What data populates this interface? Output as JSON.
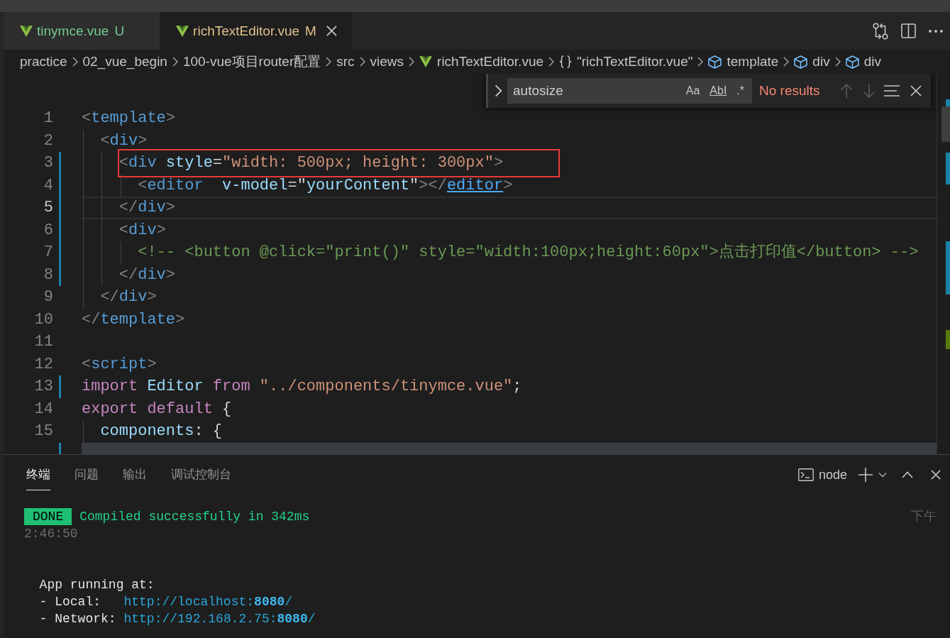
{
  "tabs": [
    {
      "label": "tinymce.vue",
      "status": "U",
      "kind": "untracked",
      "selected": false
    },
    {
      "label": "richTextEditor.vue",
      "status": "M",
      "kind": "modified",
      "selected": true
    }
  ],
  "breadcrumbs": [
    {
      "kind": "folder",
      "label": "practice"
    },
    {
      "kind": "folder",
      "label": "02_vue_begin"
    },
    {
      "kind": "folder",
      "label": "100-vue项目router配置"
    },
    {
      "kind": "folder",
      "label": "src"
    },
    {
      "kind": "folder",
      "label": "views"
    },
    {
      "kind": "file",
      "label": "richTextEditor.vue"
    },
    {
      "kind": "module",
      "label": "\"richTextEditor.vue\""
    },
    {
      "kind": "element",
      "label": "template"
    },
    {
      "kind": "element",
      "label": "div"
    },
    {
      "kind": "element",
      "label": "div"
    }
  ],
  "find": {
    "replace_expanded": false,
    "value": "autosize",
    "options": [
      {
        "kind": "match_case",
        "label": "Aa",
        "on": false
      },
      {
        "kind": "whole_word",
        "label": "AbI",
        "on": false
      },
      {
        "kind": "regex",
        "label": ".*",
        "on": false
      }
    ],
    "result": "No results",
    "previous_disabled": true,
    "next_disabled": true
  },
  "editor": {
    "lines": [
      {
        "number": "1",
        "current": false,
        "modified": false,
        "framed": false,
        "highlighted": false,
        "tokens": [
          {
            "kind": "punct",
            "text": "<"
          },
          {
            "kind": "tag",
            "text": "template"
          },
          {
            "kind": "punct",
            "text": ">"
          }
        ]
      },
      {
        "number": "2",
        "current": false,
        "modified": false,
        "framed": false,
        "highlighted": false,
        "tokens": [
          {
            "kind": "punct",
            "text": "  <"
          },
          {
            "kind": "tag",
            "text": "div"
          },
          {
            "kind": "punct",
            "text": ">"
          }
        ]
      },
      {
        "number": "3",
        "current": false,
        "modified": true,
        "framed": true,
        "highlighted": false,
        "tokens": [
          {
            "kind": "punct",
            "text": "    <"
          },
          {
            "kind": "tag",
            "text": "div"
          },
          {
            "kind": "attr",
            "text": " style"
          },
          {
            "kind": "plain",
            "text": "="
          },
          {
            "kind": "string",
            "text": "\"width: 500px; height: 300px\""
          },
          {
            "kind": "punct",
            "text": ">"
          }
        ]
      },
      {
        "number": "4",
        "current": false,
        "modified": true,
        "framed": false,
        "highlighted": false,
        "tokens": [
          {
            "kind": "punct",
            "text": "      <"
          },
          {
            "kind": "tag",
            "text": "editor"
          },
          {
            "kind": "attr",
            "text": "  v-model"
          },
          {
            "kind": "plain",
            "text": "=\""
          },
          {
            "kind": "variable",
            "text": "yourContent"
          },
          {
            "kind": "plain",
            "text": "\""
          },
          {
            "kind": "punct",
            "text": "></"
          },
          {
            "kind": "link",
            "text": "editor"
          },
          {
            "kind": "punct",
            "text": ">"
          }
        ]
      },
      {
        "number": "5",
        "current": true,
        "modified": true,
        "framed": false,
        "highlighted": false,
        "tokens": [
          {
            "kind": "punct",
            "text": "    </"
          },
          {
            "kind": "tag",
            "text": "div"
          },
          {
            "kind": "punct",
            "text": ">"
          }
        ]
      },
      {
        "number": "6",
        "current": false,
        "modified": true,
        "framed": false,
        "highlighted": false,
        "tokens": [
          {
            "kind": "punct",
            "text": "    <"
          },
          {
            "kind": "tag",
            "text": "div"
          },
          {
            "kind": "punct",
            "text": ">"
          }
        ]
      },
      {
        "number": "7",
        "current": false,
        "modified": true,
        "framed": false,
        "highlighted": false,
        "tokens": [
          {
            "kind": "comment",
            "text": "      <!-- <button @click=\"print()\" style=\"width:100px;height:60px\">点击打印值</button> -->"
          }
        ]
      },
      {
        "number": "8",
        "current": false,
        "modified": true,
        "framed": false,
        "highlighted": false,
        "tokens": [
          {
            "kind": "punct",
            "text": "    </"
          },
          {
            "kind": "tag",
            "text": "div"
          },
          {
            "kind": "punct",
            "text": ">"
          }
        ]
      },
      {
        "number": "9",
        "current": false,
        "modified": false,
        "framed": false,
        "highlighted": false,
        "tokens": [
          {
            "kind": "punct",
            "text": "  </"
          },
          {
            "kind": "tag",
            "text": "div"
          },
          {
            "kind": "punct",
            "text": ">"
          }
        ]
      },
      {
        "number": "10",
        "current": false,
        "modified": false,
        "framed": false,
        "highlighted": false,
        "tokens": [
          {
            "kind": "punct",
            "text": "</"
          },
          {
            "kind": "tag",
            "text": "template"
          },
          {
            "kind": "punct",
            "text": ">"
          }
        ]
      },
      {
        "number": "11",
        "current": false,
        "modified": false,
        "framed": false,
        "highlighted": false
      },
      {
        "number": "12",
        "current": false,
        "modified": false,
        "framed": false,
        "highlighted": false,
        "tokens": [
          {
            "kind": "punct",
            "text": "<"
          },
          {
            "kind": "tag",
            "text": "script"
          },
          {
            "kind": "punct",
            "text": ">"
          }
        ]
      },
      {
        "number": "13",
        "current": false,
        "modified": true,
        "framed": false,
        "highlighted": false,
        "tokens": [
          {
            "kind": "keyword",
            "text": "import"
          },
          {
            "kind": "variable",
            "text": " Editor"
          },
          {
            "kind": "keyword",
            "text": " from"
          },
          {
            "kind": "string",
            "text": " \"../components/tinymce.vue\""
          },
          {
            "kind": "plain",
            "text": ";"
          }
        ]
      },
      {
        "number": "14",
        "current": false,
        "modified": false,
        "framed": false,
        "highlighted": false,
        "tokens": [
          {
            "kind": "keyword",
            "text": "export default"
          },
          {
            "kind": "plain",
            "text": " {"
          }
        ]
      },
      {
        "number": "15",
        "current": false,
        "modified": false,
        "framed": false,
        "highlighted": false,
        "tokens": [
          {
            "kind": "variable",
            "text": "  components"
          },
          {
            "kind": "plain",
            "text": ": {"
          }
        ]
      },
      {
        "current": false,
        "modified": true,
        "framed": false,
        "highlighted": true
      }
    ]
  },
  "panel": {
    "tabs": [
      {
        "label": "终端",
        "selected": true
      },
      {
        "label": "问题",
        "selected": false
      },
      {
        "label": "输出",
        "selected": false
      },
      {
        "label": "调试控制台",
        "selected": false
      }
    ],
    "shell": "node",
    "output": [
      {
        "kind": "done",
        "badge": "DONE",
        "message": "Compiled successfully in 342ms",
        "aside": "下午"
      },
      {
        "kind": "muted",
        "text": "2:46:50"
      },
      {
        "kind": "blank"
      },
      {
        "kind": "blank"
      },
      {
        "kind": "plain",
        "text": "  App running at:"
      },
      {
        "kind": "url",
        "label": "  - Local:   ",
        "url": "http://localhost:**8080**/"
      },
      {
        "kind": "url",
        "label": "  - Network: ",
        "url": "http://192.168.2.75:**8080**/"
      }
    ]
  }
}
